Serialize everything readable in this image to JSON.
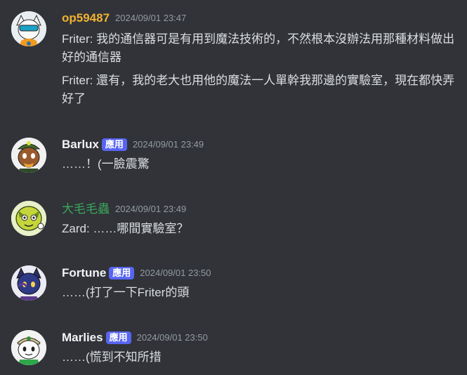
{
  "messages": [
    {
      "username": "op59487",
      "username_color": "#f0b232",
      "badge": "",
      "timestamp": "2024/09/01 23:47",
      "avatar": "character-avatar-white-orange",
      "lines": [
        "Friter: 我的通信器可是有用到魔法技術的，不然根本沒辦法用那種材料做出好的通信器",
        "Friter: 還有，我的老大也用他的魔法一人單幹我那邊的實驗室，現在都快弄好了"
      ]
    },
    {
      "username": "Barlux",
      "username_color": "#f2f3f5",
      "badge": "應用",
      "timestamp": "2024/09/01 23:49",
      "avatar": "character-avatar-brown-green-hat",
      "lines": [
        "……！(一臉震驚"
      ]
    },
    {
      "username": "大毛毛蟲",
      "username_color": "#3ba55d",
      "badge": "",
      "timestamp": "2024/09/01 23:49",
      "avatar": "character-avatar-yellow-green",
      "lines": [
        "Zard: ……哪間實驗室？"
      ]
    },
    {
      "username": "Fortune",
      "username_color": "#f2f3f5",
      "badge": "應用",
      "timestamp": "2024/09/01 23:50",
      "avatar": "character-avatar-dark-blue",
      "lines": [
        "……(打了一下Friter的頭"
      ]
    },
    {
      "username": "Marlies",
      "username_color": "#f2f3f5",
      "badge": "應用",
      "timestamp": "2024/09/01 23:50",
      "avatar": "character-avatar-white-green-cap",
      "lines": [
        "……(慌到不知所措"
      ]
    }
  ]
}
